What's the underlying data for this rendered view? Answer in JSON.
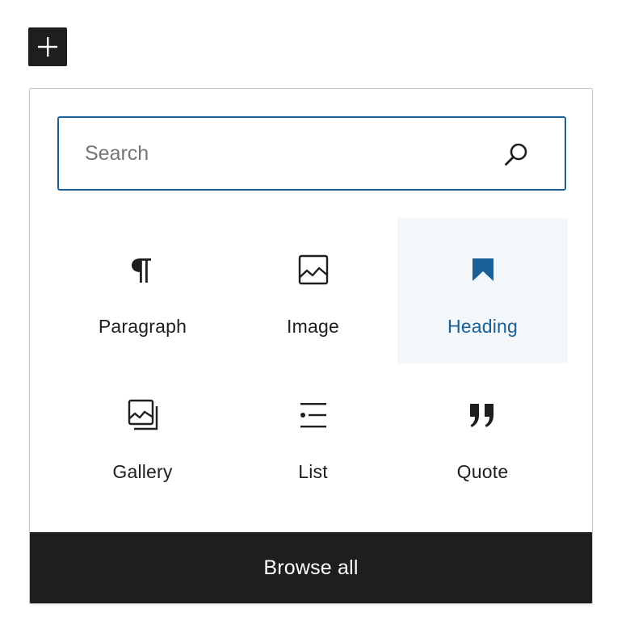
{
  "add_block_button": {
    "icon": "plus-icon"
  },
  "search": {
    "placeholder": "Search",
    "value": "",
    "icon": "search-icon",
    "border_color": "#1a6096"
  },
  "blocks": [
    {
      "label": "Paragraph",
      "icon": "paragraph-icon",
      "selected": false
    },
    {
      "label": "Image",
      "icon": "image-icon",
      "selected": false
    },
    {
      "label": "Heading",
      "icon": "bookmark-icon",
      "selected": true
    },
    {
      "label": "Gallery",
      "icon": "gallery-icon",
      "selected": false
    },
    {
      "label": "List",
      "icon": "list-icon",
      "selected": false
    },
    {
      "label": "Quote",
      "icon": "quote-icon",
      "selected": false
    }
  ],
  "browse_all": {
    "label": "Browse all"
  },
  "colors": {
    "accent": "#1a6096",
    "dark": "#1e1e1e",
    "selected_bg": "#f3f7fa"
  }
}
